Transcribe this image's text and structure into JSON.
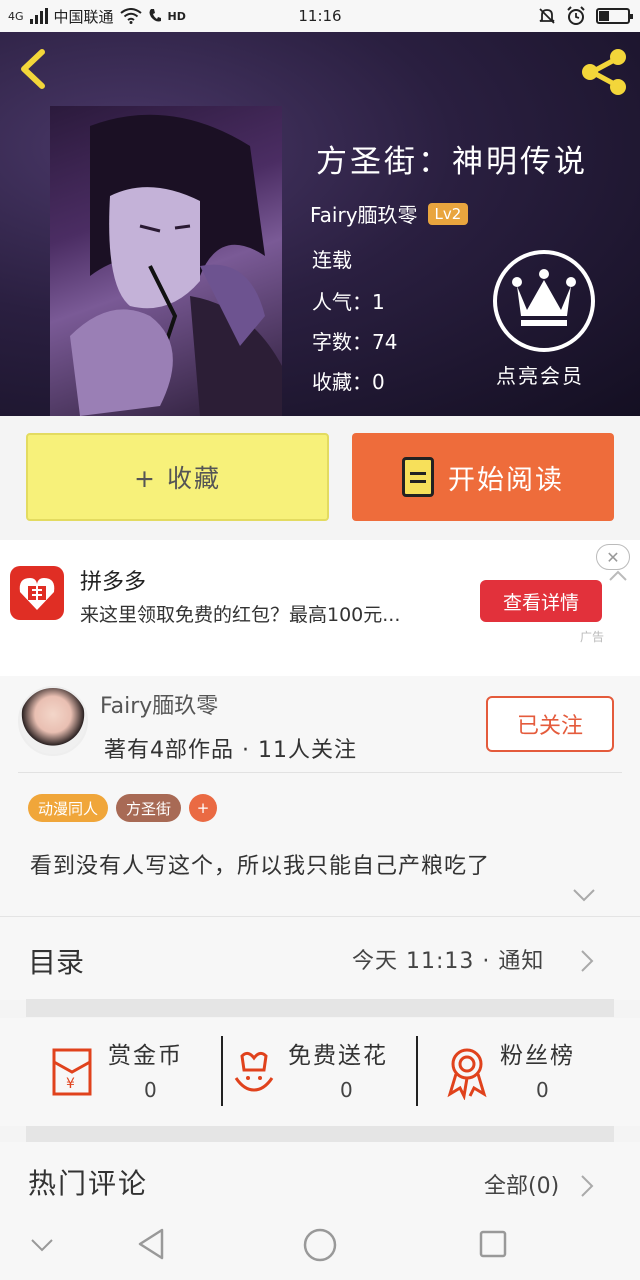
{
  "status_bar": {
    "network": "4G",
    "carrier": "中国联通",
    "hd": "HD",
    "time": "11:16",
    "battery_level": 0.35
  },
  "header": {
    "book_title": "方圣街：神明传说",
    "author_name": "Fairy腼玖零",
    "author_level": "Lv2",
    "status": "连载",
    "popularity_label": "人气：",
    "popularity": "1",
    "word_count_label": "字数：",
    "word_count": "74",
    "favorites_label": "收藏：",
    "favorites": "0",
    "vip_label": "点亮会员"
  },
  "actions": {
    "favorite_label": "+ 收藏",
    "read_label": "开始阅读"
  },
  "ad": {
    "title": "拼多多",
    "description": "来这里领取免费的红包？最高100元...",
    "button": "查看详情",
    "close": "✕",
    "mark": "广告"
  },
  "author_card": {
    "name": "Fairy腼玖零",
    "stats": "著有4部作品 · 11人关注",
    "follow_label": "已关注",
    "tags": [
      {
        "label": "动漫同人",
        "color": "#f0a63a"
      },
      {
        "label": "方圣街",
        "color": "#a86a55"
      },
      {
        "label": "+",
        "color": "#ea6a43"
      }
    ],
    "intro": "看到没有人写这个，所以我只能自己产粮吃了"
  },
  "catalog": {
    "label": "目录",
    "update": "今天 11:13 · 通知"
  },
  "stats": [
    {
      "label": "赏金币",
      "value": "0",
      "icon": "red-envelope-icon"
    },
    {
      "label": "免费送花",
      "value": "0",
      "icon": "flower-icon"
    },
    {
      "label": "粉丝榜",
      "value": "0",
      "icon": "award-ribbon-icon"
    }
  ],
  "comments": {
    "label": "热门评论",
    "all_label": "全部(0)"
  },
  "colors": {
    "accent": "#ee6c3b",
    "favorite_bg": "#f7f17a",
    "ad_button": "#e2313b",
    "follow": "#e45b3c"
  }
}
